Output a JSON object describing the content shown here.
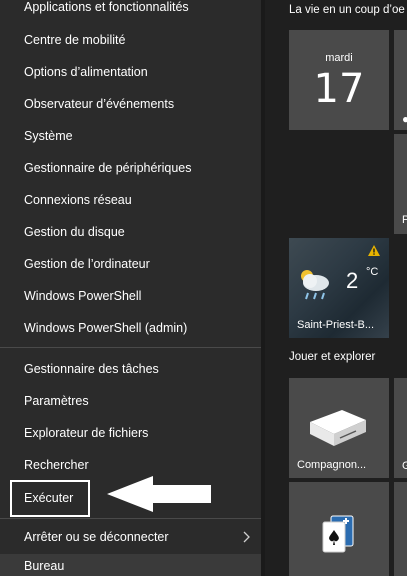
{
  "menu": {
    "items": [
      {
        "label": "Applications et fonctionnalités"
      },
      {
        "label": "Centre de mobilité"
      },
      {
        "label": "Options d’alimentation"
      },
      {
        "label": "Observateur d’événements"
      },
      {
        "label": "Système"
      },
      {
        "label": "Gestionnaire de périphériques"
      },
      {
        "label": "Connexions réseau"
      },
      {
        "label": "Gestion du disque"
      },
      {
        "label": "Gestion de l’ordinateur"
      },
      {
        "label": "Windows PowerShell"
      },
      {
        "label": "Windows PowerShell (admin)"
      },
      {
        "label": "Gestionnaire des tâches"
      },
      {
        "label": "Paramètres"
      },
      {
        "label": "Explorateur de fichiers"
      },
      {
        "label": "Rechercher"
      },
      {
        "label": "Exécuter"
      },
      {
        "label": "Arrêter ou se déconnecter"
      },
      {
        "label": "Bureau"
      }
    ]
  },
  "start": {
    "group1_title": "La vie en un coup d’oe",
    "calendar": {
      "day": "mardi",
      "date": "17"
    },
    "weather": {
      "temp": "2",
      "unit": "°C",
      "location": "Saint-Priest-B..."
    },
    "group2_title": "Jouer et explorer",
    "companion_label": "Compagnon...",
    "cut_p": "P",
    "cut_g": "G"
  },
  "colors": {
    "menu_bg": "#2b2b2b",
    "tile_bg": "#4a4a4a",
    "warning": "#e8b400"
  }
}
